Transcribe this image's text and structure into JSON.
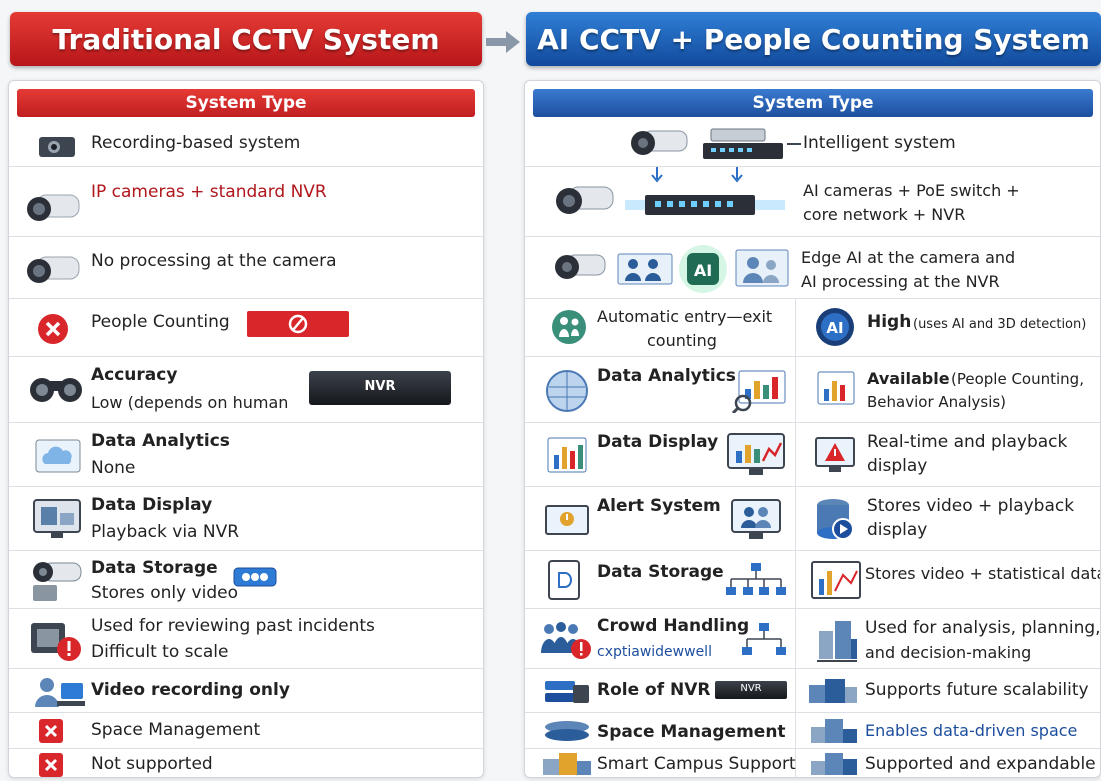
{
  "left": {
    "title": "Traditional CCTV System",
    "section": "System Type",
    "rows": {
      "system": "Recording-based system",
      "cameras": "IP cameras + standard NVR",
      "processing": "No processing at the camera",
      "counting": "People Counting",
      "accuracy_label": "Accuracy",
      "accuracy_value": "Low (depends on human",
      "nvr_badge": "NVR",
      "analytics_label": "Data Analytics",
      "analytics_value": "None",
      "display_label": "Data Display",
      "display_value": "Playback via NVR",
      "storage_label": "Data Storage",
      "storage_value": "Stores only video",
      "usage_1": "Used for reviewing past incidents",
      "usage_2": "Difficult to scale",
      "nvr_role": "Video recording only",
      "space": "Space Management",
      "campus": "Not supported"
    }
  },
  "right": {
    "title": "AI CCTV + People Counting System",
    "section": "System Type",
    "rows": {
      "system": "Intelligent system",
      "hardware_1": "AI cameras + PoE switch +",
      "hardware_2": "core network + NVR",
      "edge_1": "Edge AI at the camera and",
      "edge_2": "AI processing at the NVR",
      "counting_1": "Automatic entry—exit",
      "counting_2": "counting",
      "accuracy_label": "High",
      "accuracy_value": "(uses AI and 3D detection)",
      "analytics_label": "Data Analytics",
      "analytics_value_1": "Available",
      "analytics_value_1b": "(People Counting,",
      "analytics_value_2": "Behavior Analysis)",
      "display_label": "Data Display",
      "display_value_1": "Real-time and playback",
      "display_value_2": "display",
      "alert_label": "Alert System",
      "alert_value_1": "Stores video + playback",
      "alert_value_2": "display",
      "storage_label": "Data Storage",
      "storage_value": "Stores video + statistical data",
      "crowd_label": "Crowd Handling",
      "crowd_sub": "cxptiawidewwell",
      "crowd_value_1": "Used for analysis, planning,",
      "crowd_value_2": "and decision-making",
      "nvr_label": "Role of NVR",
      "nvr_badge": "NVR",
      "nvr_value": "Supports future scalability",
      "space_label": "Space Management",
      "space_value": "Enables data-driven space",
      "campus_label": "Smart Campus Support",
      "campus_value": "Supported and expandable"
    }
  },
  "icons": {
    "l_camera_box": "box-camera-icon",
    "l_bullet_camera": "bullet-camera-icon",
    "l_error": "x-circle-icon",
    "l_no_sign": "prohibited-icon",
    "l_binoculars": "binoculars-icon",
    "l_nvr_device": "nvr-recorder-icon",
    "l_cloud": "cloud-screen-icon",
    "l_monitor": "monitor-playback-icon",
    "l_ptz": "ptz-camera-icon",
    "l_tape": "tape-icon",
    "l_warning": "warning-icon",
    "l_user_pc": "user-computer-icon",
    "l_x_square": "x-square-icon",
    "r_switch": "network-switch-icon",
    "r_ai_chip": "ai-chip-icon",
    "r_people": "people-icon",
    "r_chart": "bar-chart-icon",
    "r_alert": "alert-screen-icon",
    "r_database": "database-icon",
    "r_network": "network-tree-icon",
    "r_building": "building-icon"
  },
  "colors": {
    "traditional_red": "#c01e21",
    "ai_blue": "#1d4e9e",
    "divider": "#dcdfe3"
  }
}
